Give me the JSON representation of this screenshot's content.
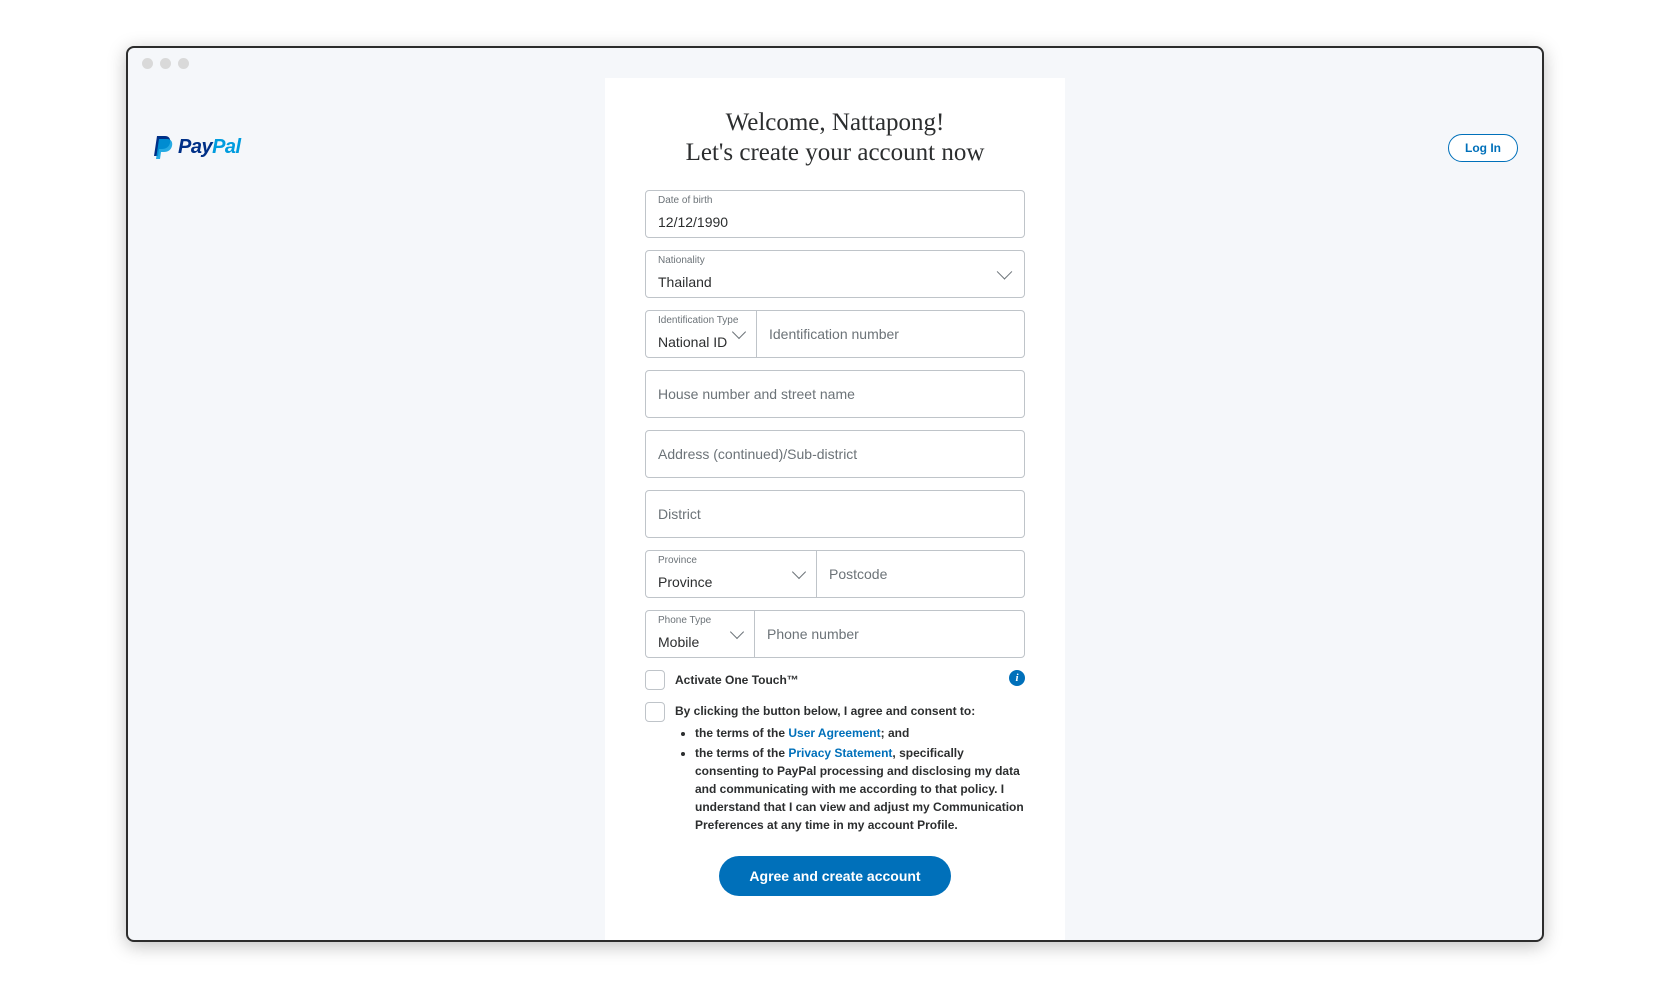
{
  "brand": {
    "name_part1": "Pay",
    "name_part2": "Pal"
  },
  "header": {
    "login_label": "Log In"
  },
  "headline": {
    "line1": "Welcome, Nattapong!",
    "line2": "Let's create your account now"
  },
  "form": {
    "dob": {
      "label": "Date of birth",
      "value": "12/12/1990"
    },
    "nationality": {
      "label": "Nationality",
      "value": "Thailand"
    },
    "id_type": {
      "label": "Identification Type",
      "value": "National ID"
    },
    "id_number": {
      "placeholder": "Identification number"
    },
    "street": {
      "placeholder": "House number and street name"
    },
    "address2": {
      "placeholder": "Address (continued)/Sub-district"
    },
    "district": {
      "placeholder": "District"
    },
    "province": {
      "label": "Province",
      "value": "Province"
    },
    "postcode": {
      "placeholder": "Postcode"
    },
    "phone_type": {
      "label": "Phone Type",
      "value": "Mobile"
    },
    "phone_number": {
      "placeholder": "Phone number"
    }
  },
  "onetouch": {
    "label": "Activate One Touch™"
  },
  "consent": {
    "intro": "By clicking the button below, I agree and consent to:",
    "bullet1_pre": "the terms of the ",
    "bullet1_link": "User Agreement",
    "bullet1_post": "; and",
    "bullet2_pre": "the terms of the ",
    "bullet2_link": "Privacy Statement",
    "bullet2_post": ", specifically consenting to PayPal processing and disclosing my data and communicating with me according to that policy. I understand that I can view and adjust my Communication Preferences at any time in my account Profile."
  },
  "submit": {
    "label": "Agree and create account"
  }
}
